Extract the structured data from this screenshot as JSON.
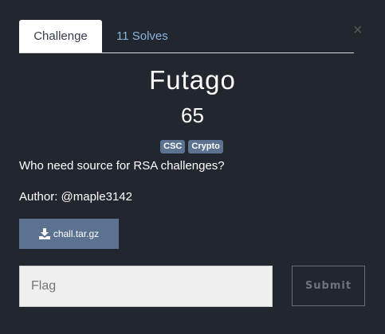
{
  "tabs": {
    "challenge": "Challenge",
    "solves": "11 Solves"
  },
  "close_glyph": "×",
  "challenge": {
    "name": "Futago",
    "points": "65",
    "tags": [
      "CSC",
      "Crypto"
    ],
    "description": "Who need source for RSA challenges?",
    "author": "Author: @maple3142"
  },
  "file": {
    "label": "chall.tar.gz",
    "icon": "download-icon"
  },
  "flag_input": {
    "placeholder": "Flag",
    "value": ""
  },
  "submit_label": "Submit"
}
